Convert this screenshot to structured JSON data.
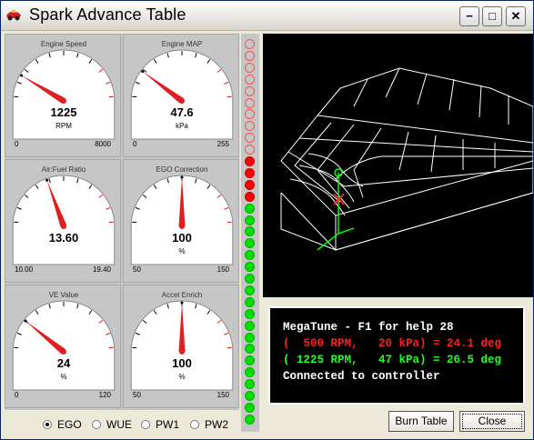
{
  "window": {
    "title": "Spark Advance Table",
    "minimize_glyph": "−",
    "maximize_glyph": "□",
    "close_glyph": "✕"
  },
  "gauges": [
    {
      "title": "Engine Speed",
      "value": "1225",
      "unit": "RPM",
      "min": "0",
      "max": "8000",
      "fraction": 0.153
    },
    {
      "title": "Engine MAP",
      "value": "47.6",
      "unit": "kPa",
      "min": "0",
      "max": "255",
      "fraction": 0.187
    },
    {
      "title": "Air:Fuel Ratio",
      "value": "13.60",
      "unit": "",
      "min": "10.00",
      "max": "19.40",
      "fraction": 0.383
    },
    {
      "title": "EGO Correction",
      "value": "100",
      "unit": "%",
      "min": "50",
      "max": "150",
      "fraction": 0.5
    },
    {
      "title": "VE Value",
      "value": "24",
      "unit": "%",
      "min": "0",
      "max": "120",
      "fraction": 0.2
    },
    {
      "title": "Accel Enrich",
      "value": "100",
      "unit": "%",
      "min": "50",
      "max": "150",
      "fraction": 0.5
    }
  ],
  "leds": [
    "off",
    "off",
    "off",
    "off",
    "off",
    "off",
    "off",
    "off",
    "off",
    "off",
    "red",
    "red",
    "red",
    "red",
    "green",
    "green",
    "green",
    "green",
    "green",
    "green",
    "green",
    "green",
    "green",
    "green",
    "green",
    "green",
    "green",
    "green",
    "green",
    "green",
    "green",
    "green",
    "green"
  ],
  "console": {
    "line1": "MegaTune - F1 for help 28",
    "line2": "(  500 RPM,   20 kPa) = 24.1 deg",
    "line3": "( 1225 RPM,   47 kPa) = 26.5 deg",
    "line4": "Connected to controller"
  },
  "radios": [
    {
      "label": "EGO",
      "selected": true
    },
    {
      "label": "WUE",
      "selected": false
    },
    {
      "label": "PW1",
      "selected": false
    },
    {
      "label": "PW2",
      "selected": false
    }
  ],
  "buttons": {
    "burn": "Burn Table",
    "close": "Close"
  },
  "colors": {
    "needle": "#e02020",
    "console_red": "#ff2020",
    "console_green": "#20ff20",
    "wire": "#ffffff",
    "cursor": "#00ff00"
  }
}
